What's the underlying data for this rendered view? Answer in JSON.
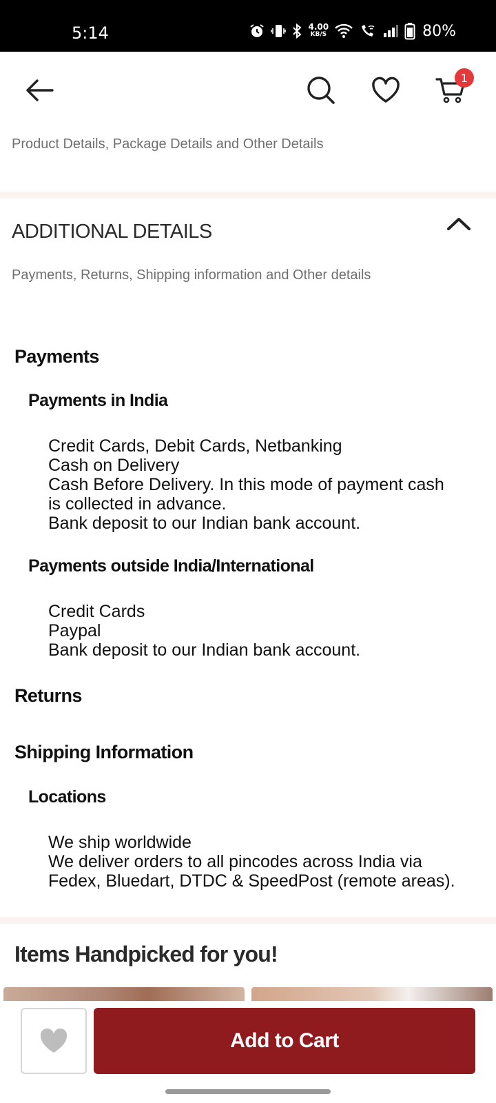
{
  "status_bar": {
    "time": "5:14",
    "net_speed_value": "4.00",
    "net_speed_unit": "KB/S",
    "battery": "80%",
    "icons": [
      "alarm-icon",
      "vibrate-icon",
      "bluetooth-icon",
      "wifi-icon",
      "wifi-calling-icon",
      "signal-icon",
      "battery-icon"
    ]
  },
  "header": {
    "icons": [
      "back-arrow-icon",
      "search-icon",
      "heart-icon",
      "cart-icon"
    ],
    "cart_count": "1"
  },
  "product_details": {
    "subtitle": "Product Details, Package Details and Other Details"
  },
  "additional_details": {
    "title": "ADDITIONAL DETAILS",
    "subtitle": "Payments, Returns, Shipping information and Other details",
    "expanded": true,
    "payments": {
      "heading": "Payments",
      "india": {
        "heading": "Payments in India",
        "lines": [
          "Credit Cards, Debit Cards, Netbanking",
          "Cash on Delivery",
          "Cash Before Delivery. In this mode of payment cash",
          "is collected in advance.",
          "Bank deposit to our Indian bank account."
        ]
      },
      "international": {
        "heading": "Payments outside India/International",
        "lines": [
          "Credit Cards",
          "Paypal",
          "Bank deposit to our Indian bank account."
        ]
      }
    },
    "returns": {
      "heading": "Returns"
    },
    "shipping": {
      "heading": "Shipping Information",
      "locations": {
        "heading": "Locations",
        "lines": [
          "We ship worldwide",
          "We deliver orders to all pincodes across India via",
          "Fedex, Bluedart, DTDC & SpeedPost (remote areas)."
        ]
      }
    }
  },
  "handpicked": {
    "title": "Items Handpicked for you!"
  },
  "bottom_bar": {
    "add_to_cart_label": "Add to Cart"
  },
  "colors": {
    "primary": "#8f1b1f",
    "badge": "#e5383b",
    "divider": "#fdf2f2"
  }
}
